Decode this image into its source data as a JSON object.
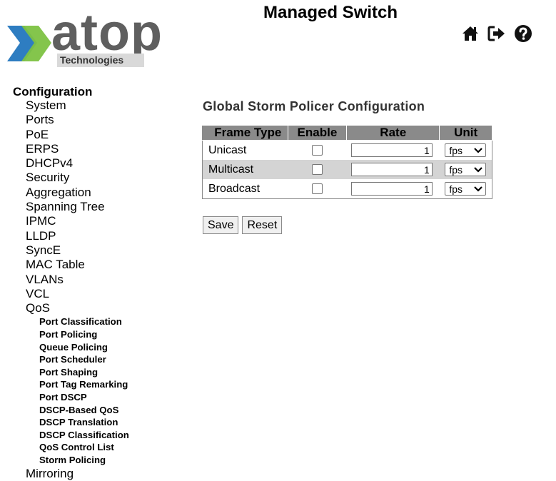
{
  "header": {
    "title": "Managed Switch",
    "logo_text": "atop",
    "logo_subtext": "Technologies",
    "icons": [
      "home-icon",
      "logout-icon",
      "help-icon"
    ]
  },
  "menu": {
    "root": "Configuration",
    "items": [
      "System",
      "Ports",
      "PoE",
      "ERPS",
      "DHCPv4",
      "Security",
      "Aggregation",
      "Spanning Tree",
      "IPMC",
      "LLDP",
      "SyncE",
      "MAC Table",
      "VLANs",
      "VCL",
      "QoS"
    ],
    "qos_subitems": [
      "Port Classification",
      "Port Policing",
      "Queue Policing",
      "Port Scheduler",
      "Port Shaping",
      "Port Tag Remarking",
      "Port DSCP",
      "DSCP-Based QoS",
      "DSCP Translation",
      "DSCP Classification",
      "QoS Control List",
      "Storm Policing"
    ],
    "next_item_partial": "Mirroring"
  },
  "main": {
    "title": "Global Storm Policer Configuration",
    "table": {
      "headers": [
        "Frame Type",
        "Enable",
        "Rate",
        "Unit"
      ],
      "rows": [
        {
          "frame_type": "Unicast",
          "enabled": false,
          "rate": "1",
          "unit": "fps"
        },
        {
          "frame_type": "Multicast",
          "enabled": false,
          "rate": "1",
          "unit": "fps"
        },
        {
          "frame_type": "Broadcast",
          "enabled": false,
          "rate": "1",
          "unit": "fps"
        }
      ]
    },
    "buttons": {
      "save": "Save",
      "reset": "Reset"
    }
  },
  "colors": {
    "logo_green": "#7dc242",
    "logo_blue": "#2e7dc1",
    "logo_gray": "#5f5f5f",
    "table_header": "#8a8a8a",
    "row_alt": "#d4d4d4"
  }
}
